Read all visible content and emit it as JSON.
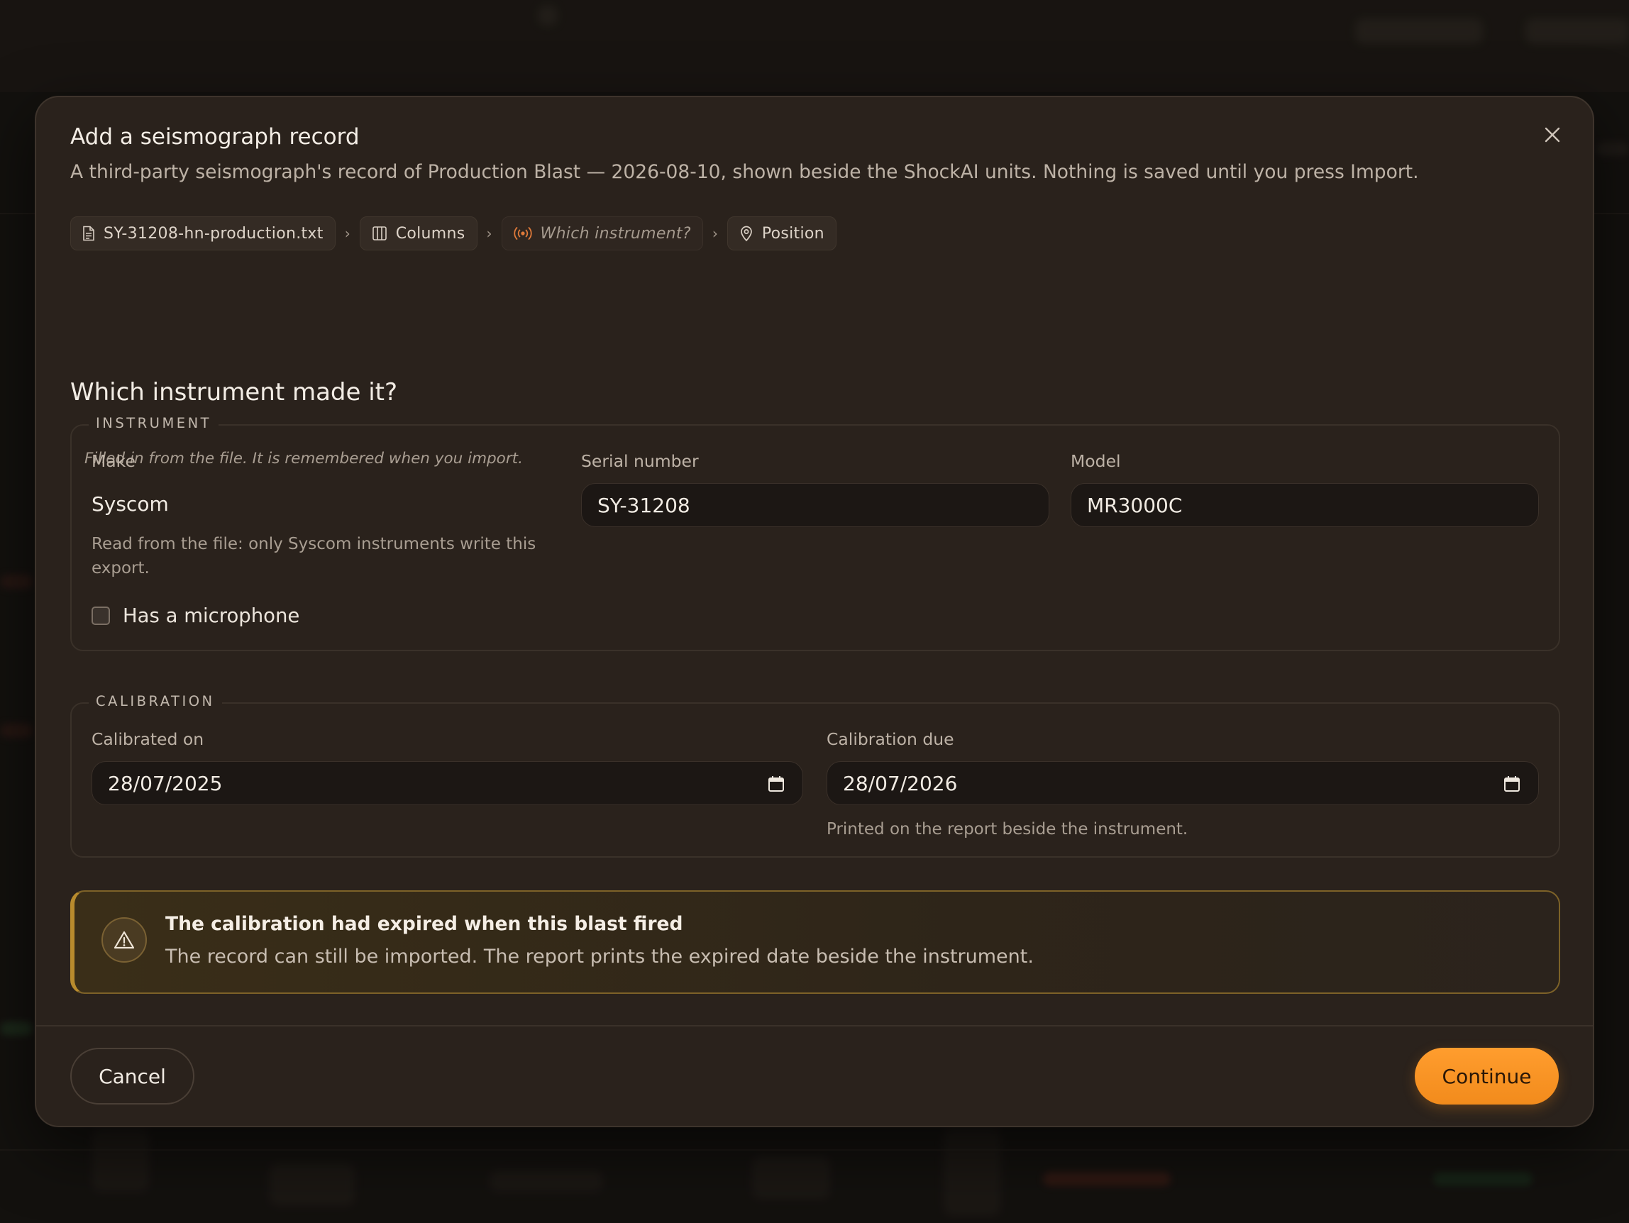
{
  "dialog": {
    "title": "Add a seismograph record",
    "subtitle": "A third-party seismograph's record of Production Blast — 2026-08-10, shown beside the ShockAI units. Nothing is saved until you press Import.",
    "close_icon": "close-icon"
  },
  "steps": [
    {
      "label": "SY-31208-hn-production.txt",
      "icon": "file-icon",
      "current": false
    },
    {
      "label": "Columns",
      "icon": "columns-icon",
      "current": false
    },
    {
      "label": "Which instrument?",
      "icon": "signal-icon",
      "current": true
    },
    {
      "label": "Position",
      "icon": "map-pin-icon",
      "current": false
    }
  ],
  "step_separator": "›",
  "section": {
    "heading": "Which instrument made it?",
    "hint": "Filled in from the file. It is remembered when you import."
  },
  "instrument": {
    "legend": "INSTRUMENT",
    "make_label": "Make",
    "make_value": "Syscom",
    "make_help": "Read from the file: only Syscom instruments write this export.",
    "serial_label": "Serial number",
    "serial_value": "SY-31208",
    "model_label": "Model",
    "model_value": "MR3000C",
    "microphone_label": "Has a microphone",
    "microphone_checked": false
  },
  "calibration": {
    "legend": "CALIBRATION",
    "calibrated_on_label": "Calibrated on",
    "calibrated_on_value": "28/07/2025",
    "due_label": "Calibration due",
    "due_value": "28/07/2026",
    "due_help": "Printed on the report beside the instrument."
  },
  "alert": {
    "icon": "warning-icon",
    "title": "The calibration had expired when this blast fired",
    "body": "The record can still be imported. The report prints the expired date beside the instrument."
  },
  "footer": {
    "cancel_label": "Cancel",
    "continue_label": "Continue"
  },
  "colors": {
    "accent": "#f28b1c",
    "warning_border": "#b88b2d",
    "current_step_icon": "#e07a3a",
    "modal_bg": "#2a221c"
  }
}
